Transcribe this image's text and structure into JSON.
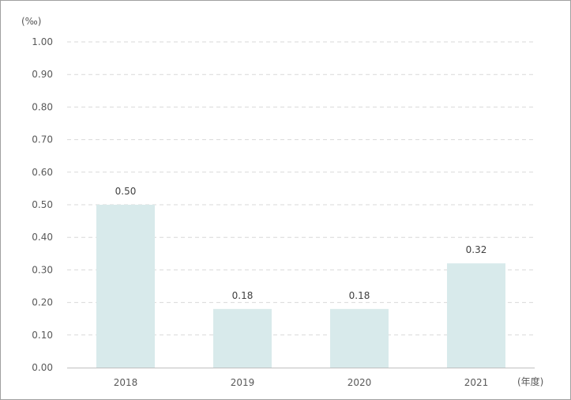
{
  "chart_data": {
    "type": "bar",
    "y_unit_label": "(‰)",
    "x_unit_label": "(年度)",
    "categories": [
      "2018",
      "2019",
      "2020",
      "2021"
    ],
    "values": [
      0.5,
      0.18,
      0.18,
      0.32
    ],
    "data_labels": [
      "0.50",
      "0.18",
      "0.18",
      "0.32"
    ],
    "y_ticks": [
      "0.00",
      "0.10",
      "0.20",
      "0.30",
      "0.40",
      "0.50",
      "0.60",
      "0.70",
      "0.80",
      "0.90",
      "1.00"
    ],
    "ylim": [
      0,
      1.0
    ],
    "grid": true,
    "bar_color": "#d8eaeb",
    "grid_color": "#d9d9d9",
    "axis_color": "#bfbfbf"
  }
}
